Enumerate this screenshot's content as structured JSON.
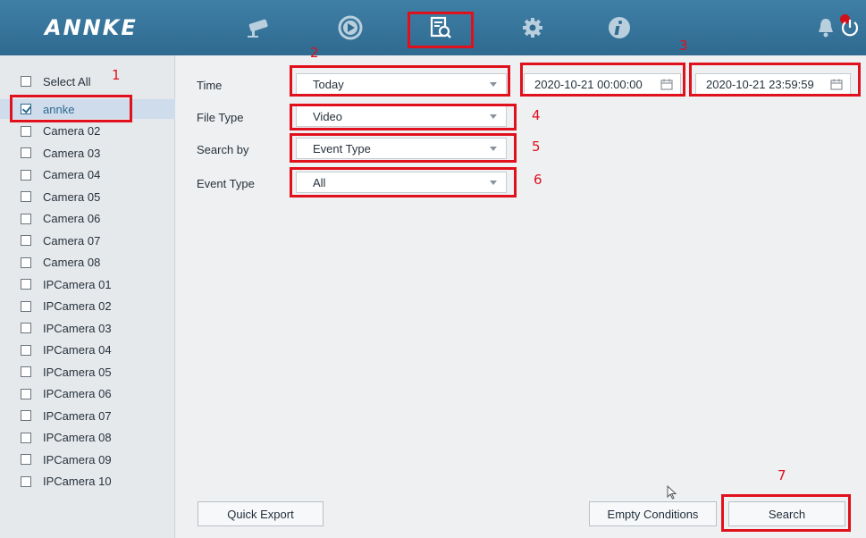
{
  "header": {
    "logo": "ANNKE",
    "nav": [
      {
        "icon": "camera-icon",
        "label": "Live View"
      },
      {
        "icon": "playback-icon",
        "label": "Playback"
      },
      {
        "icon": "search-files-icon",
        "label": "Search",
        "active": true
      },
      {
        "icon": "gear-icon",
        "label": "Configuration"
      },
      {
        "icon": "info-icon",
        "label": "Information"
      }
    ],
    "alarm_icon": "bell-icon",
    "power_icon": "power-icon"
  },
  "sidebar": {
    "select_all_label": "Select All",
    "items": [
      {
        "label": "annke",
        "checked": true
      },
      {
        "label": "Camera 02",
        "checked": false
      },
      {
        "label": "Camera 03",
        "checked": false
      },
      {
        "label": "Camera 04",
        "checked": false
      },
      {
        "label": "Camera 05",
        "checked": false
      },
      {
        "label": "Camera 06",
        "checked": false
      },
      {
        "label": "Camera 07",
        "checked": false
      },
      {
        "label": "Camera 08",
        "checked": false
      },
      {
        "label": "IPCamera 01",
        "checked": false
      },
      {
        "label": "IPCamera 02",
        "checked": false
      },
      {
        "label": "IPCamera 03",
        "checked": false
      },
      {
        "label": "IPCamera 04",
        "checked": false
      },
      {
        "label": "IPCamera 05",
        "checked": false
      },
      {
        "label": "IPCamera 06",
        "checked": false
      },
      {
        "label": "IPCamera 07",
        "checked": false
      },
      {
        "label": "IPCamera 08",
        "checked": false
      },
      {
        "label": "IPCamera 09",
        "checked": false
      },
      {
        "label": "IPCamera 10",
        "checked": false
      }
    ]
  },
  "form": {
    "time_label": "Time",
    "time_value": "Today",
    "start_time": "2020-10-21 00:00:00",
    "end_time": "2020-10-21 23:59:59",
    "file_type_label": "File Type",
    "file_type_value": "Video",
    "search_by_label": "Search by",
    "search_by_value": "Event Type",
    "event_type_label": "Event Type",
    "event_type_value": "All"
  },
  "buttons": {
    "quick_export": "Quick Export",
    "empty_conditions": "Empty Conditions",
    "search": "Search"
  },
  "annotations": [
    "1",
    "2",
    "3",
    "4",
    "5",
    "6",
    "7"
  ],
  "colors": {
    "header": "#2f6a90",
    "highlight": "#e0101c",
    "selected_row": "#cfdcec"
  }
}
